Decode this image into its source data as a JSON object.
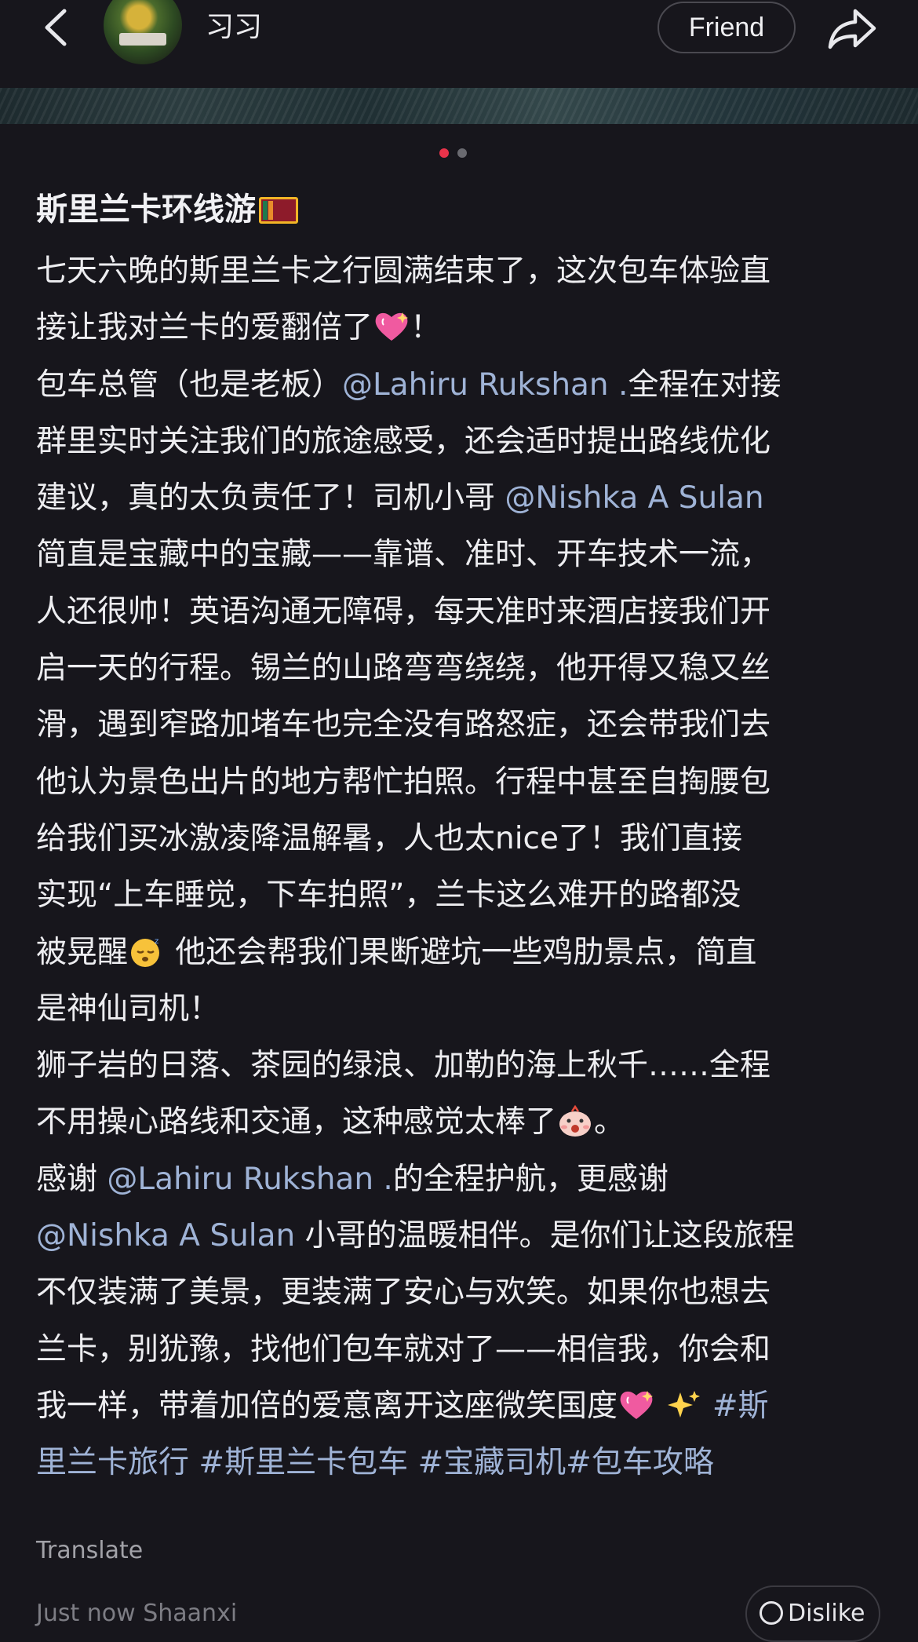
{
  "header": {
    "username": "习习",
    "friend_label": "Friend"
  },
  "carousel": {
    "active_color": "#e8334a",
    "inactive_color": "#6a6a70"
  },
  "post": {
    "title": "斯里兰卡环线游",
    "lines": [
      [
        {
          "t": "七天六晚的斯里兰卡之行圆满结束了，这次包车体验直"
        }
      ],
      [
        {
          "t": "接让我对兰卡的爱翻倍了"
        },
        {
          "emoji": "sparkling-heart"
        },
        {
          "t": "！"
        }
      ],
      [
        {
          "t": "包车总管（也是老板）"
        },
        {
          "t": "@Lahiru Rukshan .",
          "k": "mention"
        },
        {
          "t": "全程在对接"
        }
      ],
      [
        {
          "t": "群里实时关注我们的旅途感受，还会适时提出路线优化"
        }
      ],
      [
        {
          "t": "建议，真的太负责任了！司机小哥 "
        },
        {
          "t": "@Nishka A Sulan",
          "k": "mention"
        }
      ],
      [
        {
          "t": "简直是宝藏中的宝藏——靠谱、准时、开车技术一流，"
        }
      ],
      [
        {
          "t": "人还很帅！英语沟通无障碍，每天准时来酒店接我们开"
        }
      ],
      [
        {
          "t": "启一天的行程。锡兰的山路弯弯绕绕，他开得又稳又丝"
        }
      ],
      [
        {
          "t": "滑，遇到窄路加堵车也完全没有路怒症，还会带我们去"
        }
      ],
      [
        {
          "t": "他认为景色出片的地方帮忙拍照。行程中甚至自掏腰包"
        }
      ],
      [
        {
          "t": "给我们买冰激凌降温解暑，人也太nice了！我们直接"
        }
      ],
      [
        {
          "t": "实现“上车睡觉，下车拍照”，兰卡这么难开的路都没"
        }
      ],
      [
        {
          "t": "被晃醒"
        },
        {
          "emoji": "sleeping-face"
        },
        {
          "t": " 他还会帮我们果断避坑一些鸡肋景点，简直"
        }
      ],
      [
        {
          "t": "是神仙司机！"
        }
      ],
      [
        {
          "t": "狮子岩的日落、茶园的绿浪、加勒的海上秋千……全程"
        }
      ],
      [
        {
          "t": "不用操心路线和交通，这种感觉太棒了"
        },
        {
          "emoji": "excited-face"
        },
        {
          "t": "。"
        }
      ],
      [
        {
          "t": "感谢 "
        },
        {
          "t": "@Lahiru Rukshan .",
          "k": "mention"
        },
        {
          "t": "的全程护航，更感谢"
        }
      ],
      [
        {
          "t": "@Nishka A Sulan",
          "k": "mention"
        },
        {
          "t": " 小哥的温暖相伴。是你们让这段旅程"
        }
      ],
      [
        {
          "t": "不仅装满了美景，更装满了安心与欢笑。如果你也想去"
        }
      ],
      [
        {
          "t": "兰卡，别犹豫，找他们包车就对了——相信我，你会和"
        }
      ],
      [
        {
          "t": "我一样，带着加倍的爱意离开这座微笑国度"
        },
        {
          "emoji": "sparkling-heart"
        },
        {
          "t": " "
        },
        {
          "emoji": "sparkles"
        },
        {
          "t": " "
        },
        {
          "t": "#斯",
          "k": "tag"
        }
      ],
      [
        {
          "t": "里兰卡旅行 #斯里兰卡包车 #宝藏司机#包车攻略",
          "k": "tag"
        }
      ]
    ]
  },
  "footer": {
    "translate_label": "Translate",
    "meta": "Just now Shaanxi",
    "dislike_label": "Dislike"
  }
}
